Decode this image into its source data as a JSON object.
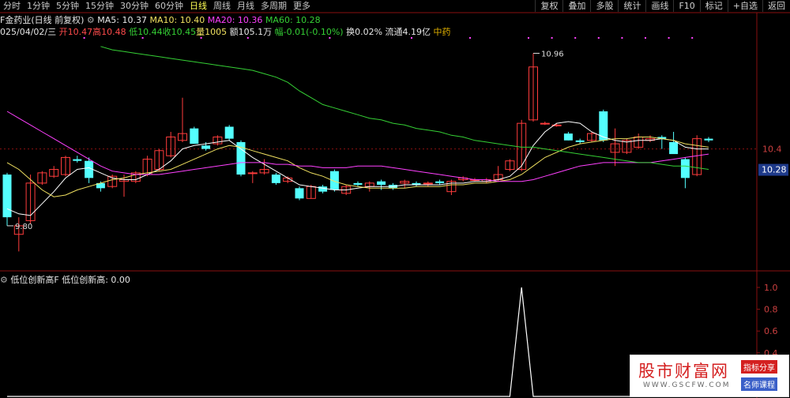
{
  "toolbar": {
    "periods": [
      "分时",
      "1分钟",
      "5分钟",
      "15分钟",
      "30分钟",
      "60分钟",
      "日线",
      "周线",
      "月线",
      "多周期",
      "更多"
    ],
    "active_index": 6,
    "right": [
      "复权",
      "叠加",
      "多股",
      "统计",
      "画线",
      "F10",
      "标记",
      "+自选",
      "返回"
    ]
  },
  "header": {
    "stock_name": "F金药业(日线 前复权)",
    "ma5": "MA5: 10.37",
    "ma10": "MA10: 10.40",
    "ma20": "MA20: 10.36",
    "ma60": "MA60: 10.28",
    "date": "025/04/02/三",
    "open": "开10.47",
    "high": "高10.48",
    "low": "低10.44",
    "close": "收10.45",
    "volume": "量1005",
    "amount": "额105.1万",
    "change": "幅-0.01(-0.10%)",
    "turnover": "换0.02%",
    "float": "流通4.19亿",
    "sector": "中药"
  },
  "sub": {
    "indicator": "低位创新高F",
    "value": "低位创新高: 0.00"
  },
  "price_axis": {
    "ticks": [
      "10.4"
    ],
    "current": "10.28"
  },
  "indicator_axis": {
    "ticks": [
      "1.0",
      "0.8",
      "0.6",
      "0.4"
    ]
  },
  "brand": {
    "name": "股市财富网",
    "url": "WWW.GSCFW.COM",
    "tag1": "指标分享",
    "tag2": "名师课程"
  },
  "colors": {
    "up": "#ff3c3c",
    "down": "#54ffff",
    "ma5": "#ffffff",
    "ma10": "#f0e060",
    "ma20": "#ff40ff",
    "ma60": "#35d035"
  },
  "chart_data": {
    "type": "candlestick",
    "price_range": [
      9.7,
      11.05
    ],
    "annotations": [
      {
        "label": "10.96",
        "bar": 45,
        "kind": "high"
      },
      {
        "label": "9.80",
        "bar": 0,
        "kind": "low"
      }
    ],
    "candles": [
      {
        "o": 10.25,
        "h": 10.26,
        "l": 9.95,
        "c": 10.0
      },
      {
        "o": 9.9,
        "h": 10.0,
        "l": 9.8,
        "c": 9.95
      },
      {
        "o": 9.98,
        "h": 10.25,
        "l": 9.96,
        "c": 10.2
      },
      {
        "o": 10.2,
        "h": 10.27,
        "l": 10.19,
        "c": 10.26
      },
      {
        "o": 10.24,
        "h": 10.3,
        "l": 10.23,
        "c": 10.28
      },
      {
        "o": 10.25,
        "h": 10.36,
        "l": 10.24,
        "c": 10.35
      },
      {
        "o": 10.34,
        "h": 10.36,
        "l": 10.32,
        "c": 10.33
      },
      {
        "o": 10.33,
        "h": 10.35,
        "l": 10.2,
        "c": 10.23
      },
      {
        "o": 10.2,
        "h": 10.21,
        "l": 10.15,
        "c": 10.17
      },
      {
        "o": 10.18,
        "h": 10.25,
        "l": 10.17,
        "c": 10.24
      },
      {
        "o": 10.21,
        "h": 10.25,
        "l": 10.12,
        "c": 10.22
      },
      {
        "o": 10.21,
        "h": 10.27,
        "l": 10.2,
        "c": 10.26
      },
      {
        "o": 10.25,
        "h": 10.36,
        "l": 10.24,
        "c": 10.34
      },
      {
        "o": 10.28,
        "h": 10.4,
        "l": 10.27,
        "c": 10.39
      },
      {
        "o": 10.36,
        "h": 10.5,
        "l": 10.35,
        "c": 10.47
      },
      {
        "o": 10.45,
        "h": 10.7,
        "l": 10.44,
        "c": 10.49
      },
      {
        "o": 10.52,
        "h": 10.53,
        "l": 10.43,
        "c": 10.43
      },
      {
        "o": 10.42,
        "h": 10.44,
        "l": 10.39,
        "c": 10.4
      },
      {
        "o": 10.43,
        "h": 10.48,
        "l": 10.42,
        "c": 10.47
      },
      {
        "o": 10.53,
        "h": 10.54,
        "l": 10.45,
        "c": 10.46
      },
      {
        "o": 10.44,
        "h": 10.45,
        "l": 10.24,
        "c": 10.25
      },
      {
        "o": 10.26,
        "h": 10.27,
        "l": 10.2,
        "c": 10.26
      },
      {
        "o": 10.26,
        "h": 10.34,
        "l": 10.25,
        "c": 10.28
      },
      {
        "o": 10.25,
        "h": 10.26,
        "l": 10.19,
        "c": 10.2
      },
      {
        "o": 10.21,
        "h": 10.24,
        "l": 10.2,
        "c": 10.23
      },
      {
        "o": 10.17,
        "h": 10.18,
        "l": 10.1,
        "c": 10.11
      },
      {
        "o": 10.11,
        "h": 10.19,
        "l": 10.11,
        "c": 10.18
      },
      {
        "o": 10.18,
        "h": 10.19,
        "l": 10.14,
        "c": 10.15
      },
      {
        "o": 10.27,
        "h": 10.28,
        "l": 10.15,
        "c": 10.16
      },
      {
        "o": 10.14,
        "h": 10.19,
        "l": 10.13,
        "c": 10.18
      },
      {
        "o": 10.2,
        "h": 10.21,
        "l": 10.18,
        "c": 10.19
      },
      {
        "o": 10.18,
        "h": 10.21,
        "l": 10.15,
        "c": 10.2
      },
      {
        "o": 10.21,
        "h": 10.22,
        "l": 10.16,
        "c": 10.19
      },
      {
        "o": 10.19,
        "h": 10.2,
        "l": 10.16,
        "c": 10.17
      },
      {
        "o": 10.2,
        "h": 10.22,
        "l": 10.17,
        "c": 10.21
      },
      {
        "o": 10.2,
        "h": 10.21,
        "l": 10.18,
        "c": 10.19
      },
      {
        "o": 10.2,
        "h": 10.21,
        "l": 10.18,
        "c": 10.2
      },
      {
        "o": 10.21,
        "h": 10.22,
        "l": 10.19,
        "c": 10.2
      },
      {
        "o": 10.15,
        "h": 10.22,
        "l": 10.13,
        "c": 10.21
      },
      {
        "o": 10.22,
        "h": 10.24,
        "l": 10.21,
        "c": 10.23
      },
      {
        "o": 10.22,
        "h": 10.23,
        "l": 10.21,
        "c": 10.22
      },
      {
        "o": 10.21,
        "h": 10.23,
        "l": 10.2,
        "c": 10.22
      },
      {
        "o": 10.22,
        "h": 10.3,
        "l": 10.21,
        "c": 10.25
      },
      {
        "o": 10.28,
        "h": 10.34,
        "l": 10.27,
        "c": 10.33
      },
      {
        "o": 10.28,
        "h": 10.57,
        "l": 10.27,
        "c": 10.55
      },
      {
        "o": 10.57,
        "h": 10.96,
        "l": 10.56,
        "c": 10.88
      },
      {
        "o": 10.55,
        "h": 10.56,
        "l": 10.54,
        "c": 10.55
      },
      {
        "o": 10.54,
        "h": 10.55,
        "l": 10.53,
        "c": 10.54
      },
      {
        "o": 10.49,
        "h": 10.5,
        "l": 10.45,
        "c": 10.45
      },
      {
        "o": 10.45,
        "h": 10.46,
        "l": 10.43,
        "c": 10.44
      },
      {
        "o": 10.45,
        "h": 10.5,
        "l": 10.44,
        "c": 10.49
      },
      {
        "o": 10.62,
        "h": 10.63,
        "l": 10.44,
        "c": 10.45
      },
      {
        "o": 10.38,
        "h": 10.52,
        "l": 10.3,
        "c": 10.43
      },
      {
        "o": 10.38,
        "h": 10.46,
        "l": 10.37,
        "c": 10.45
      },
      {
        "o": 10.41,
        "h": 10.49,
        "l": 10.4,
        "c": 10.47
      },
      {
        "o": 10.45,
        "h": 10.48,
        "l": 10.44,
        "c": 10.46
      },
      {
        "o": 10.47,
        "h": 10.48,
        "l": 10.4,
        "c": 10.46
      },
      {
        "o": 10.44,
        "h": 10.5,
        "l": 10.38,
        "c": 10.37
      },
      {
        "o": 10.34,
        "h": 10.35,
        "l": 10.17,
        "c": 10.23
      },
      {
        "o": 10.25,
        "h": 10.48,
        "l": 10.24,
        "c": 10.46
      },
      {
        "o": 10.46,
        "h": 10.47,
        "l": 10.44,
        "c": 10.45
      }
    ],
    "ma": [
      {
        "name": "MA5",
        "points": [
          10.05,
          10.02,
          10.01,
          10.08,
          10.15,
          10.23,
          10.28,
          10.29,
          10.26,
          10.23,
          10.22,
          10.22,
          10.25,
          10.28,
          10.33,
          10.4,
          10.42,
          10.43,
          10.44,
          10.45,
          10.4,
          10.35,
          10.31,
          10.27,
          10.23,
          10.19,
          10.18,
          10.17,
          10.16,
          10.16,
          10.17,
          10.18,
          10.18,
          10.18,
          10.19,
          10.19,
          10.19,
          10.19,
          10.2,
          10.2,
          10.21,
          10.21,
          10.22,
          10.24,
          10.3,
          10.42,
          10.5,
          10.55,
          10.56,
          10.55,
          10.5,
          10.47,
          10.45,
          10.44,
          10.45,
          10.45,
          10.46,
          10.45,
          10.41,
          10.4,
          10.4
        ]
      },
      {
        "name": "MA10",
        "points": [
          10.32,
          10.28,
          10.22,
          10.16,
          10.12,
          10.13,
          10.16,
          10.18,
          10.2,
          10.22,
          10.23,
          10.25,
          10.26,
          10.27,
          10.28,
          10.31,
          10.34,
          10.37,
          10.4,
          10.42,
          10.41,
          10.39,
          10.37,
          10.35,
          10.33,
          10.29,
          10.26,
          10.24,
          10.21,
          10.19,
          10.18,
          10.17,
          10.17,
          10.17,
          10.17,
          10.18,
          10.18,
          10.18,
          10.19,
          10.19,
          10.2,
          10.2,
          10.21,
          10.22,
          10.25,
          10.3,
          10.35,
          10.38,
          10.41,
          10.43,
          10.44,
          10.45,
          10.46,
          10.46,
          10.47,
          10.47,
          10.46,
          10.45,
          10.43,
          10.42,
          10.41
        ]
      },
      {
        "name": "MA20",
        "points": [
          10.62,
          10.58,
          10.54,
          10.5,
          10.46,
          10.42,
          10.38,
          10.34,
          10.3,
          10.27,
          10.26,
          10.25,
          10.25,
          10.25,
          10.26,
          10.27,
          10.28,
          10.29,
          10.3,
          10.31,
          10.32,
          10.32,
          10.32,
          10.31,
          10.31,
          10.3,
          10.3,
          10.29,
          10.29,
          10.29,
          10.3,
          10.3,
          10.3,
          10.29,
          10.28,
          10.27,
          10.26,
          10.25,
          10.24,
          10.23,
          10.22,
          10.22,
          10.21,
          10.21,
          10.21,
          10.22,
          10.24,
          10.26,
          10.28,
          10.3,
          10.31,
          10.32,
          10.32,
          10.32,
          10.32,
          10.32,
          10.33,
          10.34,
          10.35,
          10.36,
          10.37
        ]
      },
      {
        "name": "MA60",
        "points": [
          null,
          null,
          null,
          null,
          null,
          null,
          null,
          null,
          11.0,
          10.98,
          10.97,
          10.96,
          10.95,
          10.94,
          10.93,
          10.92,
          10.91,
          10.9,
          10.89,
          10.88,
          10.87,
          10.86,
          10.84,
          10.82,
          10.79,
          10.74,
          10.7,
          10.66,
          10.64,
          10.62,
          10.6,
          10.58,
          10.57,
          10.55,
          10.54,
          10.52,
          10.51,
          10.5,
          10.48,
          10.47,
          10.45,
          10.44,
          10.43,
          10.42,
          10.41,
          10.41,
          10.4,
          10.39,
          10.38,
          10.37,
          10.36,
          10.35,
          10.34,
          10.33,
          10.32,
          10.32,
          10.31,
          10.3,
          10.3,
          10.29,
          10.28
        ]
      }
    ],
    "signal_markers": [
      7,
      12,
      17,
      21,
      28,
      35,
      40,
      45,
      47,
      49,
      51,
      53,
      55,
      57,
      59
    ],
    "indicator": {
      "name": "低位创新高",
      "range": [
        0,
        1.0
      ],
      "values": [
        0,
        0,
        0,
        0,
        0,
        0,
        0,
        0,
        0,
        0,
        0,
        0,
        0,
        0,
        0,
        0,
        0,
        0,
        0,
        0,
        0,
        0,
        0,
        0,
        0,
        0,
        0,
        0,
        0,
        0,
        0,
        0,
        0,
        0,
        0,
        0,
        0,
        0,
        0,
        0,
        0,
        0,
        0,
        0,
        1.0,
        0,
        0,
        0,
        0,
        0,
        0,
        0,
        0,
        0,
        0,
        0,
        0,
        0,
        0,
        0,
        0
      ]
    }
  }
}
